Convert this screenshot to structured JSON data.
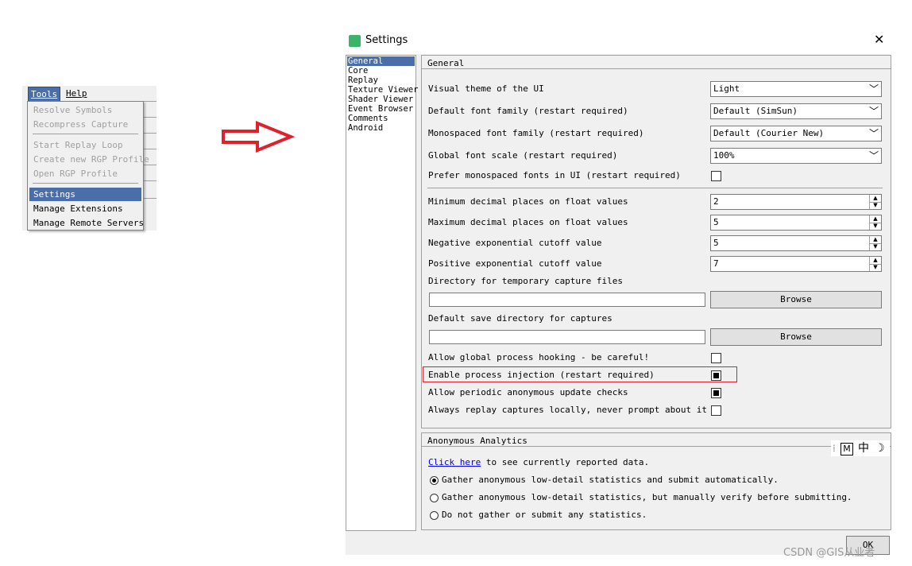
{
  "menu": {
    "tools_label": "Tools",
    "help_label": "Help",
    "items": [
      {
        "label": "Resolve Symbols",
        "enabled": false
      },
      {
        "label": "Recompress Capture",
        "enabled": false
      },
      {
        "label": "Start Replay Loop",
        "enabled": false
      },
      {
        "label": "Create new RGP Profile",
        "enabled": false
      },
      {
        "label": "Open RGP Profile",
        "enabled": false
      },
      {
        "label": "Settings",
        "enabled": true,
        "selected": true
      },
      {
        "label": "Manage Extensions",
        "enabled": true
      },
      {
        "label": "Manage Remote Servers",
        "enabled": true
      }
    ]
  },
  "dialog": {
    "title": "Settings",
    "close_glyph": "✕",
    "nav": [
      "General",
      "Core",
      "Replay",
      "Texture Viewer",
      "Shader Viewer",
      "Event Browser",
      "Comments",
      "Android"
    ],
    "selected_nav": "General",
    "general": {
      "group_title": "General",
      "theme_label": "Visual theme of the UI",
      "theme_value": "Light",
      "font_label": "Default font family (restart required)",
      "font_value": "Default (SimSun)",
      "mono_label": "Monospaced font family (restart required)",
      "mono_value": "Default (Courier New)",
      "scale_label": "Global font scale (restart required)",
      "scale_value": "100%",
      "prefer_mono_label": "Prefer monospaced fonts in UI (restart required)",
      "prefer_mono_checked": false,
      "min_dec_label": "Minimum decimal places on float values",
      "min_dec_value": "2",
      "max_dec_label": "Maximum decimal places on float values",
      "max_dec_value": "5",
      "neg_exp_label": "Negative exponential cutoff value",
      "neg_exp_value": "5",
      "pos_exp_label": "Positive exponential cutoff value",
      "pos_exp_value": "7",
      "temp_dir_label": "Directory for temporary capture files",
      "temp_dir_value": "",
      "save_dir_label": "Default save directory for captures",
      "save_dir_value": "",
      "browse_label": "Browse",
      "hooking_label": "Allow global process hooking - be careful!",
      "hooking_checked": false,
      "injection_label": "Enable process injection (restart required)",
      "injection_checked": true,
      "update_label": "Allow periodic anonymous update checks",
      "update_checked": true,
      "replay_local_label": "Always replay captures locally, never prompt about it",
      "replay_local_checked": false
    },
    "analytics": {
      "group_title": "Anonymous Analytics",
      "link_text": "Click here",
      "link_suffix": " to see currently reported data.",
      "options": [
        {
          "label": "Gather anonymous low-detail statistics and submit automatically.",
          "selected": true
        },
        {
          "label": "Gather anonymous low-detail statistics, but manually verify before submitting.",
          "selected": false
        },
        {
          "label": "Do not gather or submit any statistics.",
          "selected": false
        }
      ]
    },
    "ok_label": "OK"
  },
  "ime": {
    "mode": "M",
    "lang": "中",
    "moon": "☽"
  },
  "watermark": "CSDN @GIS从业者",
  "colors": {
    "selection": "#4a6ea9",
    "highlight_box": "#e0202a",
    "arrow": "#e0202a"
  }
}
